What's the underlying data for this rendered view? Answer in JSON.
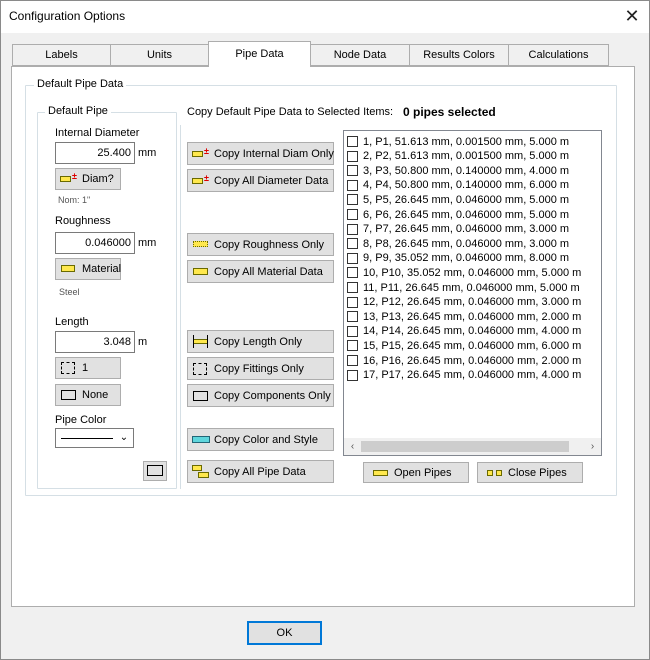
{
  "window": {
    "title": "Configuration Options",
    "close_glyph": "✕"
  },
  "tabs": [
    {
      "label": "Labels"
    },
    {
      "label": "Units"
    },
    {
      "label": "Pipe Data"
    },
    {
      "label": "Node Data"
    },
    {
      "label": "Results Colors"
    },
    {
      "label": "Calculations"
    }
  ],
  "group_default_pipe_data": "Default Pipe Data",
  "group_default_pipe": "Default Pipe",
  "internal_diameter": {
    "label": "Internal Diameter",
    "value": "25.400",
    "unit": "mm"
  },
  "diam_button": "Diam?",
  "nom_text": "Nom: 1\"",
  "roughness": {
    "label": "Roughness",
    "value": "0.046000",
    "unit": "mm"
  },
  "material_button": "Material",
  "material_value": "Steel",
  "length": {
    "label": "Length",
    "value": "3.048",
    "unit": "m"
  },
  "fittings_button": "1",
  "components_button": "None",
  "pipe_color_label": "Pipe Color",
  "copy_header": "Copy Default Pipe Data to Selected Items:",
  "pipes_selected": "0 pipes selected",
  "copy_buttons": {
    "internal_diam": "Copy Internal Diam Only",
    "all_diameter": "Copy All Diameter Data",
    "roughness": "Copy Roughness Only",
    "all_material": "Copy All Material Data",
    "length": "Copy Length Only",
    "fittings": "Copy Fittings Only",
    "components": "Copy Components Only",
    "color_style": "Copy Color and Style",
    "all_pipe": "Copy All Pipe Data"
  },
  "pipes": [
    "1, P1, 51.613 mm, 0.001500 mm, 5.000 m",
    "2, P2, 51.613 mm, 0.001500 mm, 5.000 m",
    "3, P3, 50.800 mm, 0.140000 mm, 4.000 m",
    "4, P4, 50.800 mm, 0.140000 mm, 6.000 m",
    "5, P5, 26.645 mm, 0.046000 mm, 5.000 m",
    "6, P6, 26.645 mm, 0.046000 mm, 5.000 m",
    "7, P7, 26.645 mm, 0.046000 mm, 3.000 m",
    "8, P8, 26.645 mm, 0.046000 mm, 3.000 m",
    "9, P9, 35.052 mm, 0.046000 mm, 8.000 m",
    "10, P10, 35.052 mm, 0.046000 mm, 5.000 m",
    "11, P11, 26.645 mm, 0.046000 mm, 5.000 m",
    "12, P12, 26.645 mm, 0.046000 mm, 3.000 m",
    "13, P13, 26.645 mm, 0.046000 mm, 2.000 m",
    "14, P14, 26.645 mm, 0.046000 mm, 4.000 m",
    "15, P15, 26.645 mm, 0.046000 mm, 6.000 m",
    "16, P16, 26.645 mm, 0.046000 mm, 2.000 m",
    "17, P17, 26.645 mm, 0.046000 mm, 4.000 m"
  ],
  "scroll_left": "‹",
  "scroll_right": "›",
  "combo_chevron": "⌄",
  "open_pipes_button": "Open Pipes",
  "close_pipes_button": "Close Pipes",
  "ok_button": "OK",
  "colors": {
    "accent": "#0078d7",
    "icon_yellow": "#ffe84d",
    "icon_cyan": "#5fd6dc"
  },
  "icons": [
    "diameter-icon",
    "material-icon",
    "fittings-icon",
    "components-icon",
    "numbering-icon",
    "roughness-icon",
    "length-icon",
    "color-style-icon",
    "all-pipe-data-icon",
    "open-pipes-icon",
    "close-pipes-icon"
  ]
}
